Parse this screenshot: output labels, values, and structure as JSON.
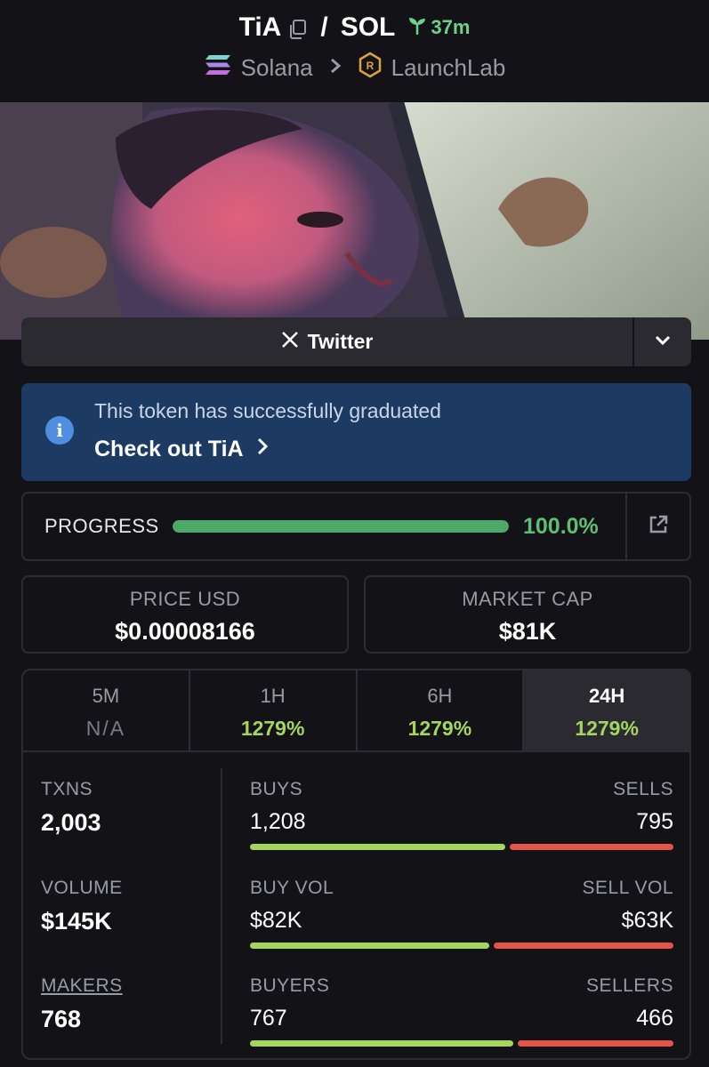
{
  "header": {
    "token_symbol": "TiA",
    "separator": "/",
    "quote_symbol": "SOL",
    "age": "37m",
    "chain": "Solana",
    "launchpad": "LaunchLab"
  },
  "social": {
    "twitter_label": "Twitter"
  },
  "notice": {
    "message": "This token has successfully graduated",
    "link_label": "Check out TiA"
  },
  "progress": {
    "label": "PROGRESS",
    "value_text": "100.0%",
    "fraction": 1.0
  },
  "price": {
    "label": "PRICE USD",
    "value": "$0.00008166"
  },
  "market_cap": {
    "label": "MARKET CAP",
    "value": "$81K"
  },
  "tabs": [
    {
      "label": "5M",
      "value": "N/A"
    },
    {
      "label": "1H",
      "value": "1279%"
    },
    {
      "label": "6H",
      "value": "1279%"
    },
    {
      "label": "24H",
      "value": "1279%"
    }
  ],
  "stats": {
    "txns": {
      "label": "TXNS",
      "value": "2,003"
    },
    "volume": {
      "label": "VOLUME",
      "value": "$145K"
    },
    "makers": {
      "label": "MAKERS",
      "value": "768"
    },
    "buys": {
      "label": "BUYS",
      "value": "1,208",
      "fraction": 0.603
    },
    "sells": {
      "label": "SELLS",
      "value": "795"
    },
    "buy_vol": {
      "label": "BUY VOL",
      "value": "$82K",
      "fraction": 0.566
    },
    "sell_vol": {
      "label": "SELL VOL",
      "value": "$63K"
    },
    "buyers": {
      "label": "BUYERS",
      "value": "767",
      "fraction": 0.622
    },
    "sellers": {
      "label": "SELLERS",
      "value": "466"
    }
  },
  "colors": {
    "positive": "#a4d65e",
    "negative": "#e5544b",
    "progress": "#4ea867",
    "notice_bg": "#1d3a63"
  }
}
